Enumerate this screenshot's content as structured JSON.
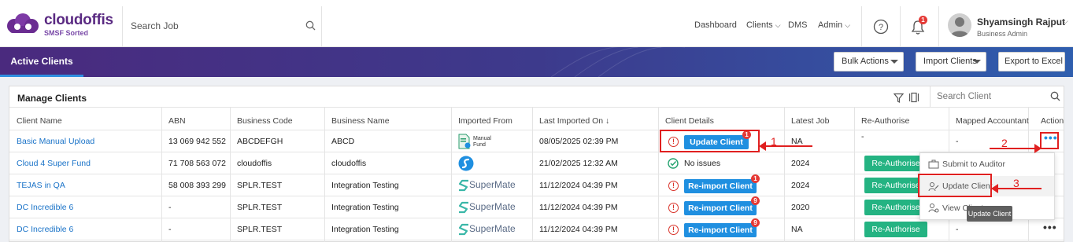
{
  "brand": {
    "name": "cloudoffis",
    "tagline": "SMSF Sorted",
    "color": "#5a2a82"
  },
  "search_job": {
    "placeholder": "Search Job"
  },
  "nav": {
    "dashboard": "Dashboard",
    "clients": "Clients",
    "dms": "DMS",
    "admin": "Admin"
  },
  "notifications": {
    "count": "1"
  },
  "user": {
    "name": "Shyamsingh Rajput",
    "role": "Business Admin"
  },
  "band": {
    "active_tab": "Active Clients",
    "bulk_actions": "Bulk Actions",
    "import_clients": "Import Clients",
    "export_excel": "Export to Excel"
  },
  "panel": {
    "title": "Manage Clients",
    "search_placeholder": "Search Client"
  },
  "columns": [
    "Client Name",
    "ABN",
    "Business Code",
    "Business Name",
    "Imported From",
    "Last Imported On",
    "Client Details",
    "Latest Job",
    "Re-Authorise",
    "Mapped Accountant",
    "Action"
  ],
  "rows": [
    {
      "client": "Basic Manual Upload",
      "abn": "13 069 942 552",
      "code": "ABCDEFGH",
      "bname": "ABCD",
      "source": "Manual Fund",
      "imported": "08/05/2025 02:39 PM",
      "details_btn": "Update Client",
      "badge": "1",
      "job": "NA",
      "reauth": "-",
      "accountant": "-"
    },
    {
      "client": "Cloud 4 Super Fund",
      "abn": "71 708 563 072",
      "code": "cloudoffis",
      "bname": "cloudoffis",
      "source": "",
      "imported": "21/02/2025 12:32 AM",
      "details_text": "No issues",
      "job": "2024",
      "reauth": "Re-Authorise"
    },
    {
      "client": "TEJAS in QA",
      "abn": "58 008 393 299",
      "code": "SPLR.TEST",
      "bname": "Integration Testing",
      "source": "SuperMate",
      "imported": "11/12/2024 04:39 PM",
      "details_btn": "Re-import Client",
      "badge": "1",
      "job": "2024",
      "reauth": "Re-Authorise"
    },
    {
      "client": "DC Incredible 6",
      "abn": "-",
      "code": "SPLR.TEST",
      "bname": "Integration Testing",
      "source": "SuperMate",
      "imported": "11/12/2024 04:39 PM",
      "details_btn": "Re-import Client",
      "badge": "9",
      "job": "2020",
      "reauth": "Re-Authorise"
    },
    {
      "client": "DC Incredible 6",
      "abn": "-",
      "code": "SPLR.TEST",
      "bname": "Integration Testing",
      "source": "SuperMate",
      "imported": "11/12/2024 04:39 PM",
      "details_btn": "Re-import Client",
      "badge": "9",
      "job": "NA",
      "reauth": "Re-Authorise",
      "accountant": "-"
    }
  ],
  "action_menu": {
    "submit": "Submit to Auditor",
    "update": "Update Client",
    "view": "View Client"
  },
  "tooltip": "Update Client",
  "annotations": [
    "1",
    "2",
    "3"
  ],
  "colors": {
    "link": "#1a73c8",
    "primary_button": "#1f8fe0",
    "reauthorise": "#24b382",
    "warning": "#d9342b",
    "annotation": "#e02020"
  }
}
